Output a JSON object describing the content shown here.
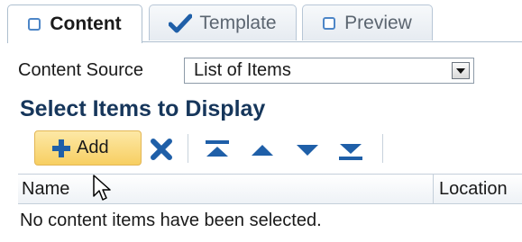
{
  "tabs": [
    {
      "label": "Content",
      "icon": "checkbox-icon",
      "active": true
    },
    {
      "label": "Template",
      "icon": "checkmark-icon",
      "active": false
    },
    {
      "label": "Preview",
      "icon": "checkbox-icon",
      "active": false
    }
  ],
  "content_source": {
    "label": "Content Source",
    "selected": "List of Items"
  },
  "section_title": "Select Items to Display",
  "toolbar": {
    "add_label": "Add",
    "icons": [
      "plus-icon",
      "delete-x-icon",
      "move-top-icon",
      "move-up-icon",
      "move-down-icon",
      "move-bottom-icon"
    ]
  },
  "table": {
    "columns": [
      "Name",
      "Location"
    ],
    "empty_message": "No content items have been selected."
  },
  "colors": {
    "accent_blue": "#1f5fa8",
    "tab_border": "#aebfcf",
    "add_button": "#f7cf62",
    "title_text": "#16365b"
  }
}
